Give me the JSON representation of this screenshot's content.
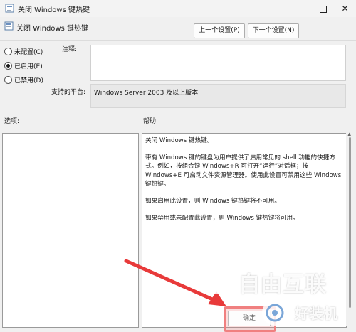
{
  "window": {
    "title": "关闭 Windows 键热键",
    "minimize_icon": "minimize-icon",
    "maximize_icon": "maximize-icon",
    "close_icon": "close-icon"
  },
  "header": {
    "policy_name": "关闭 Windows 键热键",
    "prev_button": "上一个设置(P)",
    "next_button": "下一个设置(N)"
  },
  "state_options": [
    {
      "label": "未配置(C)",
      "selected": false
    },
    {
      "label": "已启用(E)",
      "selected": true
    },
    {
      "label": "已禁用(D)",
      "selected": false
    }
  ],
  "comment": {
    "label": "注释:",
    "value": ""
  },
  "platform": {
    "label": "支持的平台:",
    "value": "Windows Server 2003 及以上版本"
  },
  "options_section": {
    "label": "选项:"
  },
  "help_section": {
    "label": "帮助:",
    "paragraphs": [
      "关闭 Windows 键热键。",
      "带有 Windows 键的键盘为用户提供了启用常见的 shell 功能的快捷方式。例如，按组合键 Windows+R 可打开“运行”对话框；按 Windows+E 可启动文件资源管理器。使用此设置可禁用这些 Windows 键热键。",
      "如果启用此设置，则 Windows 键热键将不可用。",
      "如果禁用或未配置此设置，则 Windows 键热键将可用。"
    ]
  },
  "footer": {
    "ok_button": "确定"
  },
  "watermark": {
    "text1": "自由互联",
    "text2": "好装机"
  },
  "colors": {
    "annotation_arrow": "#e83a3a",
    "highlight": "#f08080"
  }
}
